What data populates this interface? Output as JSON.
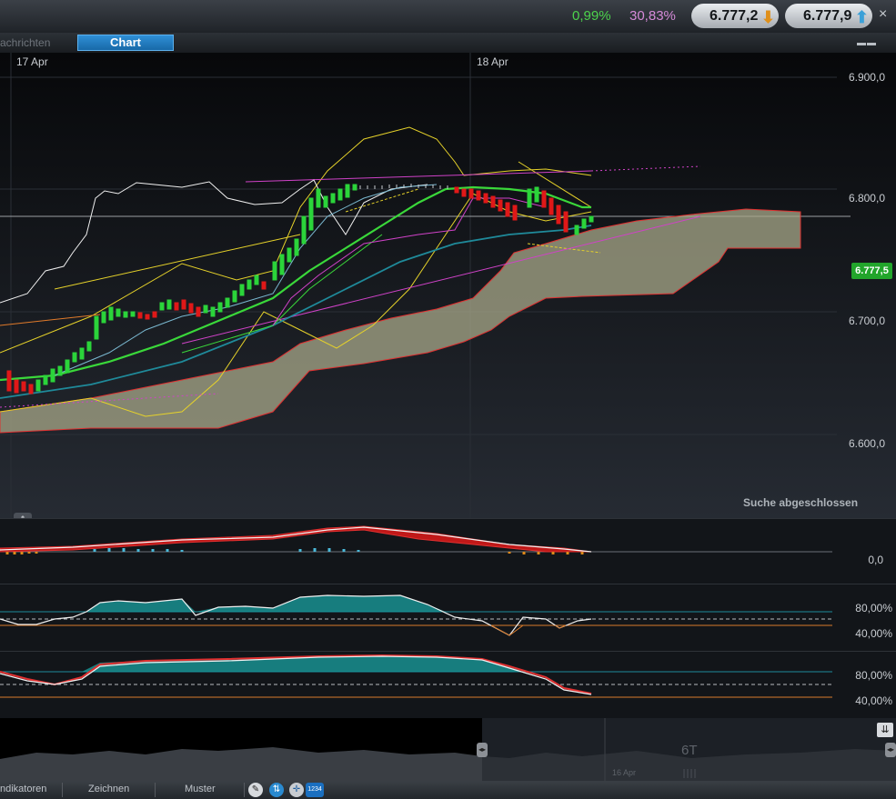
{
  "header": {
    "change_green": "0,99%",
    "change_pink": "30,83%",
    "bid_price": "6.777,2",
    "ask_price": "6.777,9",
    "close_symbol": "×"
  },
  "tabs": {
    "news_label": "achrichten",
    "chart_label": "Chart",
    "window_controls": "▬▬"
  },
  "chart": {
    "dates": [
      "17 Apr",
      "18 Apr"
    ],
    "y_labels": [
      "6.900,0",
      "6.800,0",
      "6.700,0",
      "6.600,0"
    ],
    "last_price": "6.777,5",
    "status": "Suche abgeschlossen",
    "collapse_symbol": "⇕"
  },
  "indicators": {
    "macd_label": "0,0",
    "stoch1_high": "80,00%",
    "stoch1_low": "40,00%",
    "stoch2_high": "80,00%",
    "stoch2_low": "40,00%"
  },
  "navigator": {
    "period_label": "6T",
    "date_label": "16 Apr",
    "left_handle": "◂▸",
    "right_handle": "◂▸",
    "expand_icon": "⇊"
  },
  "bottom_tabs": {
    "indicators": "ndikatoren",
    "draw": "Zeichnen",
    "pattern": "Muster",
    "tool_number": "1234"
  },
  "colors": {
    "green_candle": "#2bd43a",
    "red_candle": "#e01818",
    "cloud_fill": "#a8a88a",
    "accent_blue": "#1f7ec4"
  }
}
